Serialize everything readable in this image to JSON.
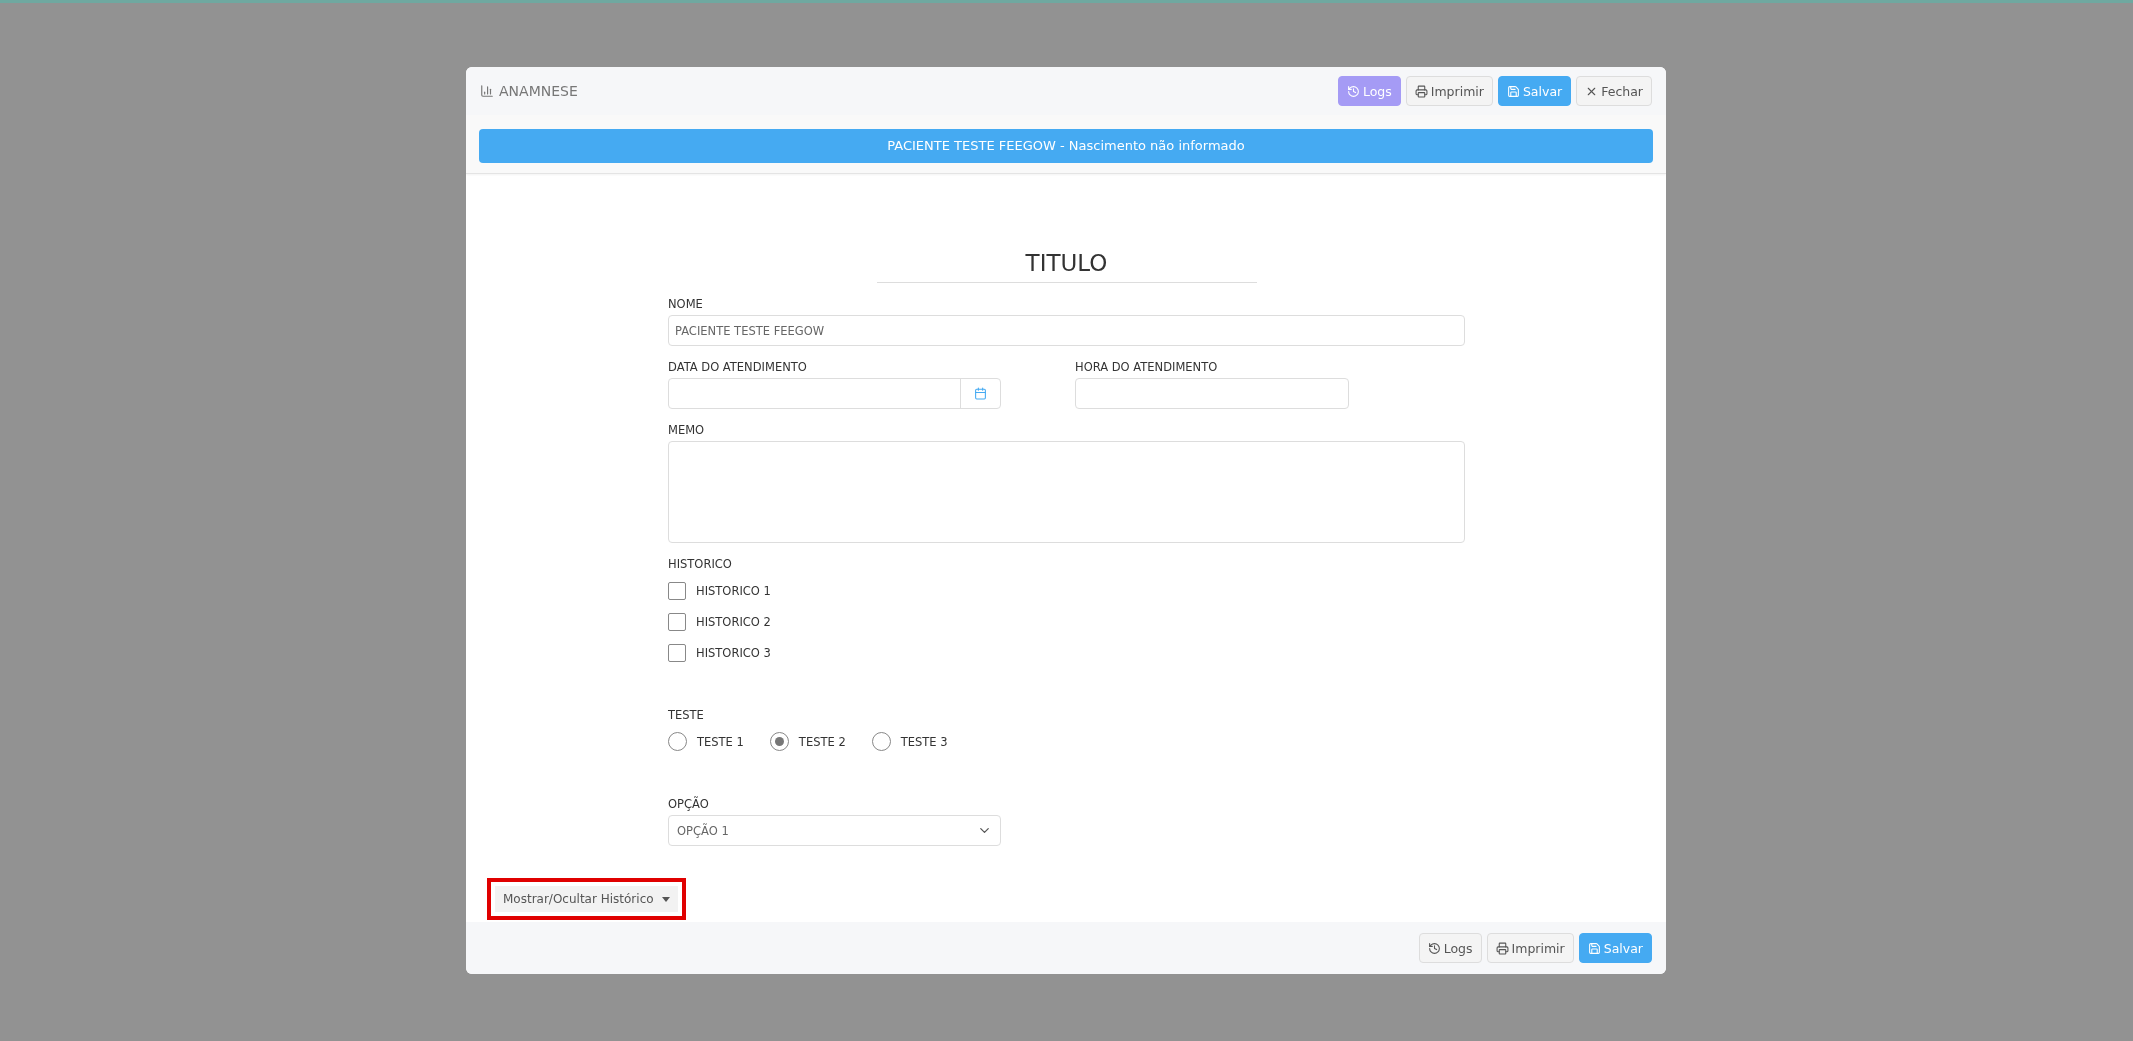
{
  "modal": {
    "title": "ANAMNESE",
    "header_buttons": [
      {
        "kind": "logs",
        "label": "Logs"
      },
      {
        "kind": "print",
        "label": "Imprimir"
      },
      {
        "kind": "save",
        "label": "Salvar"
      },
      {
        "kind": "close",
        "label": "Fechar"
      }
    ],
    "patient_banner": "PACIENTE TESTE FEEGOW - Nascimento não informado",
    "form": {
      "title": "TITULO",
      "rows": [
        [
          {
            "kind": "text",
            "label": "NOME",
            "value": "PACIENTE TESTE FEEGOW"
          }
        ],
        [
          {
            "kind": "date",
            "label": "DATA DO ATENDIMENTO"
          },
          {
            "kind": "time",
            "label": "HORA DO ATENDIMENTO"
          }
        ],
        [
          {
            "kind": "textarea",
            "label": "MEMO"
          }
        ],
        [
          {
            "kind": "checkboxes",
            "label": "HISTORICO",
            "options": [
              {
                "label": "HISTORICO 1",
                "checked": false
              },
              {
                "label": "HISTORICO 2",
                "checked": false
              },
              {
                "label": "HISTORICO 3",
                "checked": false
              }
            ]
          }
        ],
        [
          {
            "kind": "radios",
            "label": "TESTE",
            "options": [
              {
                "label": "TESTE 1",
                "selected": false
              },
              {
                "label": "TESTE 2",
                "selected": true
              },
              {
                "label": "TESTE 3",
                "selected": false
              }
            ]
          }
        ],
        [
          {
            "kind": "select",
            "label": "OPÇÃO",
            "value": "OPÇÃO 1"
          }
        ]
      ]
    },
    "history_toggle": {
      "label": "Mostrar/Ocultar Histórico",
      "highlighted": true
    },
    "footer_buttons": [
      {
        "kind": "logs",
        "label": "Logs"
      },
      {
        "kind": "print",
        "label": "Imprimir"
      },
      {
        "kind": "save",
        "label": "Salvar"
      }
    ]
  }
}
